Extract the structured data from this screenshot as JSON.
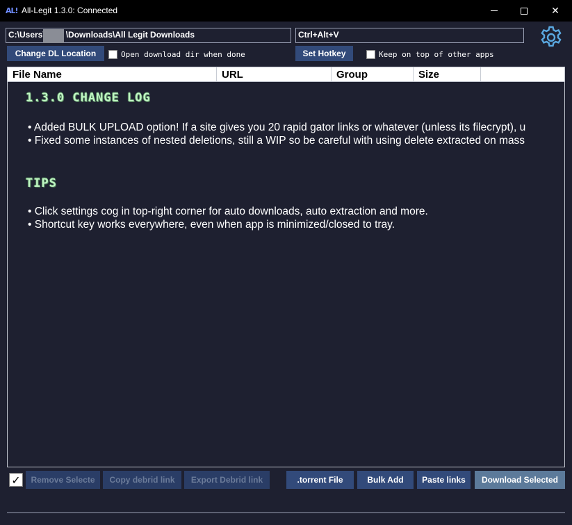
{
  "window": {
    "logo_text": "AL!",
    "title": "All-Legit 1.3.0: Connected"
  },
  "top": {
    "download_path": "C:\\Users\\         \\Downloads\\All Legit Downloads",
    "hotkey_value": "Ctrl+Alt+V",
    "change_dl_label": "Change DL Location",
    "open_dir_label": "Open download dir when done",
    "set_hotkey_label": "Set Hotkey",
    "keep_on_top_label": "Keep on top of other apps"
  },
  "table": {
    "columns": [
      "File Name",
      "URL",
      "Group",
      "Size"
    ]
  },
  "content": {
    "changelog_heading": "1.3.0 CHANGE LOG",
    "changelog_lines": [
      "• Added BULK UPLOAD option! If a site gives you 20 rapid gator links or whatever (unless its filecrypt), u",
      "• Fixed some instances of nested deletions, still a WIP so be careful with using delete extracted on mass"
    ],
    "tips_heading": "TIPS",
    "tips_lines": [
      "• Click settings cog in top-right corner for auto downloads, auto extraction and more.",
      "• Shortcut key works everywhere, even when app is minimized/closed to tray."
    ]
  },
  "bottom": {
    "select_all_check": "✓",
    "remove_label": "Remove Selecte",
    "copy_label": "Copy  debrid link",
    "export_label": "Export  Debrid link",
    "torrent_label": ".torrent File",
    "bulk_label": "Bulk Add",
    "paste_label": "Paste links",
    "download_label": "Download Selected"
  }
}
